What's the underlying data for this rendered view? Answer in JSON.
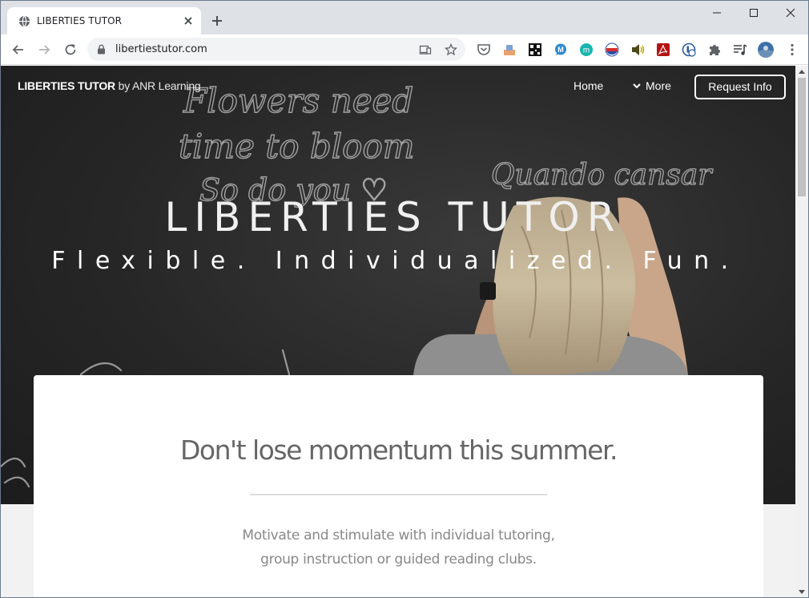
{
  "browser": {
    "tab_title": "LIBERTIES TUTOR",
    "url": "libertiestutor.com",
    "tab_favicon": "globe-icon",
    "extensions": [
      "pocket-icon",
      "bookmark-tray-icon",
      "qr-icon",
      "chat-bubble-icon",
      "m-circle-icon",
      "flag-icon",
      "speaker-icon",
      "pdf-icon",
      "password-icon",
      "puzzle-icon",
      "playlist-icon",
      "profile-avatar"
    ]
  },
  "site": {
    "brand_name": "LIBERTIES TUTOR",
    "brand_by": "by ANR Learning",
    "nav": {
      "home": "Home",
      "more": "More",
      "cta": "Request Info"
    },
    "hero": {
      "title": "LIBERTIES TUTOR",
      "subtitle": "Flexible. Individualized. Fun.",
      "chalk_lines": [
        "Flowers need",
        "time to bloom",
        "So do you ♡",
        "Quando cansar"
      ]
    },
    "card": {
      "heading": "Don't lose momentum this summer.",
      "body_line1": "Motivate and stimulate with individual tutoring,",
      "body_line2": "group instruction or guided reading clubs."
    }
  },
  "colors": {
    "tabstrip": "#dee1e6",
    "hero_bg": "#262626",
    "card_text": "#666666",
    "body_text": "#888888"
  }
}
